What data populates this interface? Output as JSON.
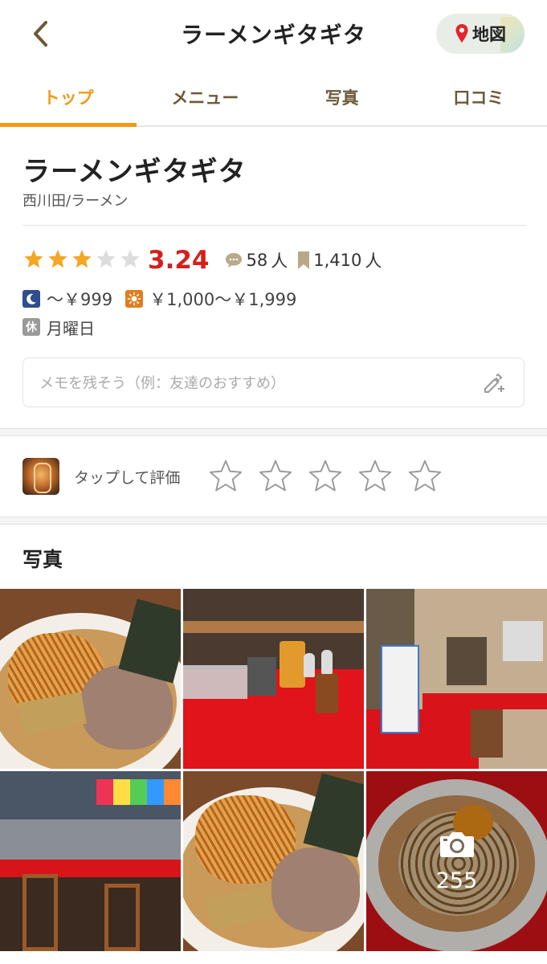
{
  "header": {
    "title": "ラーメンギタギタ",
    "map_label": "地図"
  },
  "tabs": [
    {
      "label": "トップ",
      "active": true
    },
    {
      "label": "メニュー",
      "active": false
    },
    {
      "label": "写真",
      "active": false
    },
    {
      "label": "口コミ",
      "active": false
    }
  ],
  "shop": {
    "name": "ラーメンギタギタ",
    "genre": "西川田/ラーメン",
    "rating": {
      "value": 3.24,
      "display": "3.24",
      "stars_filled": 3,
      "stars_total": 5
    },
    "review_count": "58",
    "review_unit": "人",
    "bookmark_count": "1,410",
    "bookmark_unit": "人",
    "price_dinner": "～￥999",
    "price_lunch": "￥1,000～￥1,999",
    "holiday_badge": "休",
    "holiday": "月曜日"
  },
  "memo": {
    "placeholder": "メモを残そう（例：友達のおすすめ）"
  },
  "rate_prompt": {
    "label": "タップして評価",
    "stars": 5
  },
  "photos": {
    "title": "写真",
    "more_count": "255"
  },
  "colors": {
    "accent": "#f39a13",
    "rating": "#d4201a",
    "star_filled": "#f5a623",
    "star_empty": "#dddddd"
  }
}
